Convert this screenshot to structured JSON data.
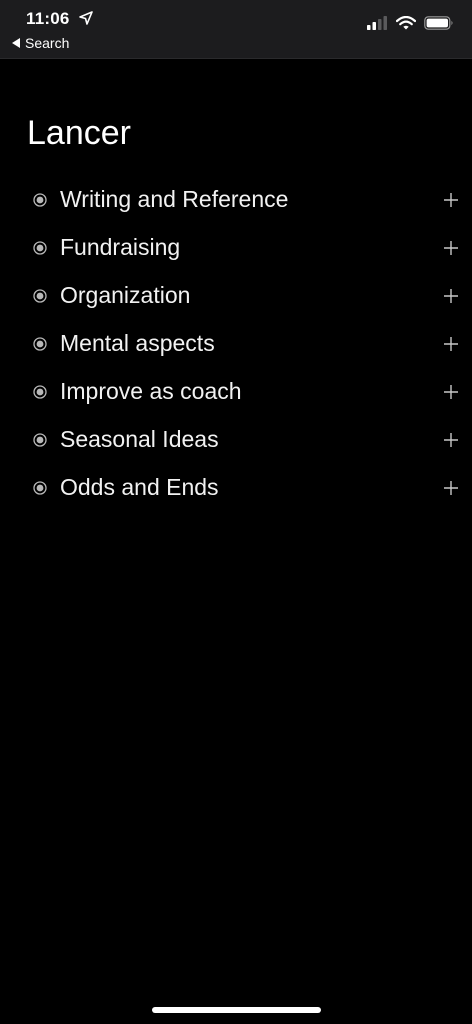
{
  "status_bar": {
    "time": "11:06",
    "back_label": "Search"
  },
  "page": {
    "title": "Lancer"
  },
  "topics": [
    {
      "label": "Writing and Reference"
    },
    {
      "label": "Fundraising"
    },
    {
      "label": "Organization"
    },
    {
      "label": "Mental aspects"
    },
    {
      "label": "Improve as coach"
    },
    {
      "label": "Seasonal Ideas"
    },
    {
      "label": "Odds and Ends"
    }
  ],
  "icons": {
    "bullet": "radio-bullet-icon",
    "add": "plus-icon",
    "location": "location-arrow-icon",
    "back": "back-triangle-icon",
    "signal": "cellular-signal-icon",
    "wifi": "wifi-icon",
    "battery": "battery-icon"
  },
  "colors": {
    "background": "#000000",
    "status_bar": "#1c1c1e",
    "text": "#f2f2f2",
    "icon": "#b8b8b8"
  }
}
